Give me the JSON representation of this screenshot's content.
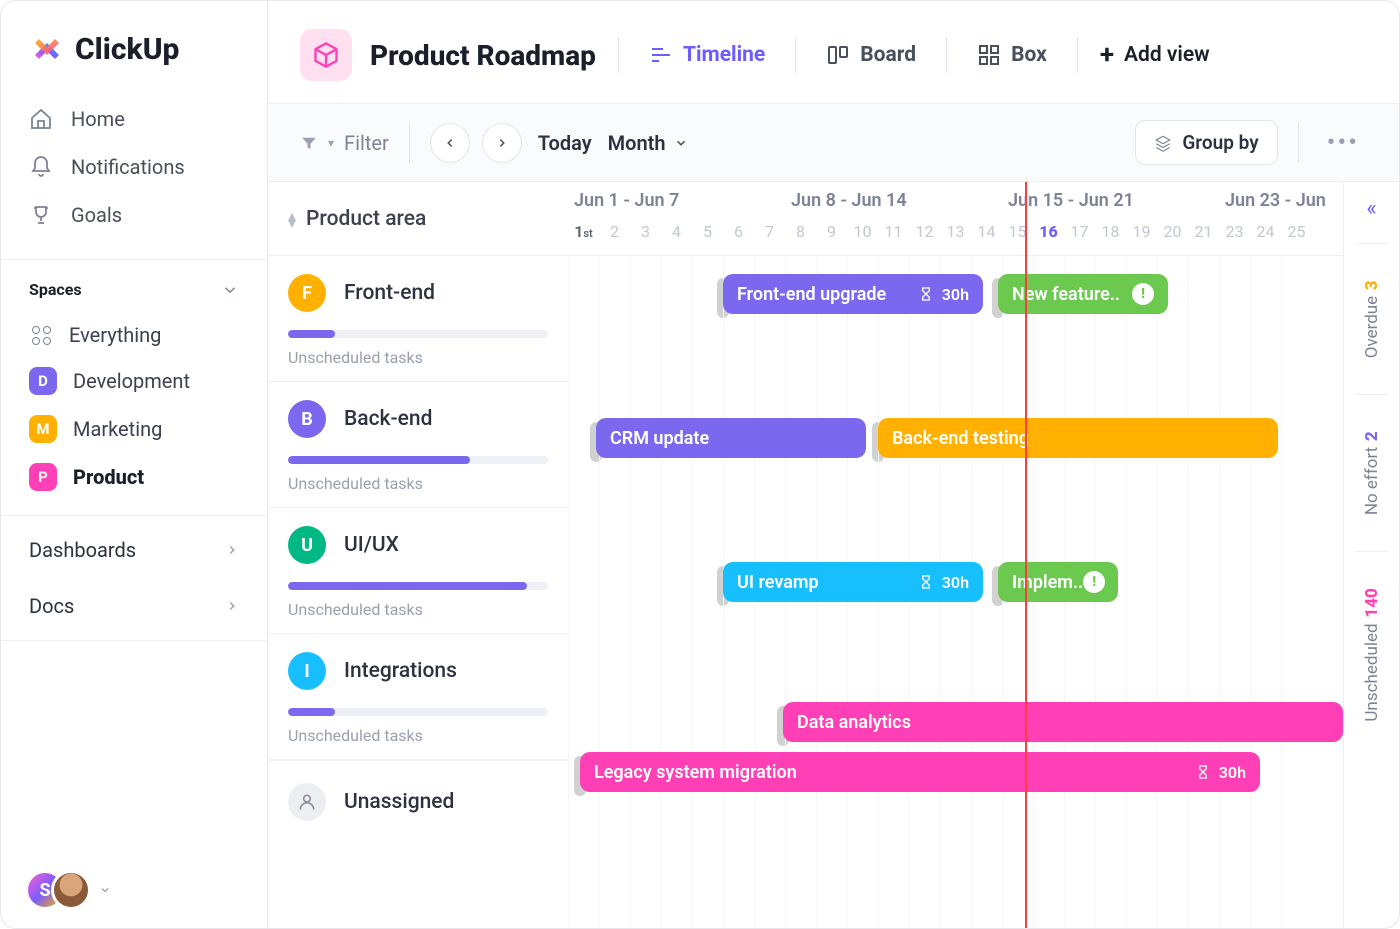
{
  "brand": "ClickUp",
  "nav": {
    "home": "Home",
    "notifications": "Notifications",
    "goals": "Goals"
  },
  "spacesHeader": "Spaces",
  "spaces": {
    "everything": "Everything",
    "items": [
      {
        "letter": "D",
        "label": "Development",
        "color": "#7b68ee"
      },
      {
        "letter": "M",
        "label": "Marketing",
        "color": "#ffb000"
      },
      {
        "letter": "P",
        "label": "Product",
        "color": "#ff3fb5"
      }
    ]
  },
  "sections": {
    "dashboards": "Dashboards",
    "docs": "Docs"
  },
  "avatarLetter": "S",
  "page": {
    "title": "Product Roadmap",
    "views": {
      "timeline": "Timeline",
      "board": "Board",
      "box": "Box",
      "add": "Add view"
    }
  },
  "toolbar": {
    "filter": "Filter",
    "today": "Today",
    "range": "Month",
    "groupby": "Group by"
  },
  "timeline": {
    "columnTitle": "Product area",
    "weeks": [
      "Jun 1 - Jun 7",
      "Jun 8 - Jun 14",
      "Jun 15 - Jun 21",
      "Jun 23 - Jun"
    ],
    "days": [
      "1",
      "2",
      "3",
      "4",
      "5",
      "6",
      "7",
      "8",
      "9",
      "10",
      "11",
      "12",
      "13",
      "14",
      "15",
      "16",
      "17",
      "18",
      "19",
      "20",
      "21",
      "23",
      "24",
      "25"
    ],
    "todayIndex": 15,
    "unscheduledLabel": "Unscheduled tasks",
    "unassigned": "Unassigned",
    "areas": [
      {
        "letter": "F",
        "name": "Front-end",
        "color": "#ffb000",
        "progress": 18
      },
      {
        "letter": "B",
        "name": "Back-end",
        "color": "#7b68ee",
        "progress": 70
      },
      {
        "letter": "U",
        "name": "UI/UX",
        "color": "#00b884",
        "progress": 92
      },
      {
        "letter": "I",
        "name": "Integrations",
        "color": "#18bfff",
        "progress": 18
      }
    ],
    "bars": {
      "frontend_upgrade": {
        "label": "Front-end upgrade",
        "time": "30h"
      },
      "new_feature": {
        "label": "New feature.."
      },
      "crm_update": {
        "label": "CRM update"
      },
      "backend_testing": {
        "label": "Back-end testing"
      },
      "ui_revamp": {
        "label": "UI revamp",
        "time": "30h"
      },
      "implem": {
        "label": "Implem.."
      },
      "data_analytics": {
        "label": "Data analytics"
      },
      "legacy": {
        "label": "Legacy system migration",
        "time": "30h"
      }
    }
  },
  "rail": {
    "overdue": {
      "n": "3",
      "label": "Overdue",
      "color": "#ffb000"
    },
    "noeffort": {
      "n": "2",
      "label": "No effort",
      "color": "#7b68ee"
    },
    "unscheduled": {
      "n": "140",
      "label": "Unscheduled",
      "color": "#ff3fb5"
    }
  }
}
